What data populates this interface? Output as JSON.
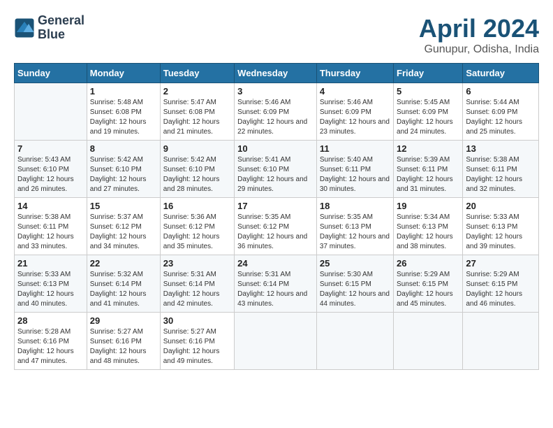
{
  "logo": {
    "line1": "General",
    "line2": "Blue"
  },
  "title": "April 2024",
  "subtitle": "Gunupur, Odisha, India",
  "weekdays": [
    "Sunday",
    "Monday",
    "Tuesday",
    "Wednesday",
    "Thursday",
    "Friday",
    "Saturday"
  ],
  "weeks": [
    [
      {
        "day": "",
        "sunrise": "",
        "sunset": "",
        "daylight": ""
      },
      {
        "day": "1",
        "sunrise": "Sunrise: 5:48 AM",
        "sunset": "Sunset: 6:08 PM",
        "daylight": "Daylight: 12 hours and 19 minutes."
      },
      {
        "day": "2",
        "sunrise": "Sunrise: 5:47 AM",
        "sunset": "Sunset: 6:08 PM",
        "daylight": "Daylight: 12 hours and 21 minutes."
      },
      {
        "day": "3",
        "sunrise": "Sunrise: 5:46 AM",
        "sunset": "Sunset: 6:09 PM",
        "daylight": "Daylight: 12 hours and 22 minutes."
      },
      {
        "day": "4",
        "sunrise": "Sunrise: 5:46 AM",
        "sunset": "Sunset: 6:09 PM",
        "daylight": "Daylight: 12 hours and 23 minutes."
      },
      {
        "day": "5",
        "sunrise": "Sunrise: 5:45 AM",
        "sunset": "Sunset: 6:09 PM",
        "daylight": "Daylight: 12 hours and 24 minutes."
      },
      {
        "day": "6",
        "sunrise": "Sunrise: 5:44 AM",
        "sunset": "Sunset: 6:09 PM",
        "daylight": "Daylight: 12 hours and 25 minutes."
      }
    ],
    [
      {
        "day": "7",
        "sunrise": "Sunrise: 5:43 AM",
        "sunset": "Sunset: 6:10 PM",
        "daylight": "Daylight: 12 hours and 26 minutes."
      },
      {
        "day": "8",
        "sunrise": "Sunrise: 5:42 AM",
        "sunset": "Sunset: 6:10 PM",
        "daylight": "Daylight: 12 hours and 27 minutes."
      },
      {
        "day": "9",
        "sunrise": "Sunrise: 5:42 AM",
        "sunset": "Sunset: 6:10 PM",
        "daylight": "Daylight: 12 hours and 28 minutes."
      },
      {
        "day": "10",
        "sunrise": "Sunrise: 5:41 AM",
        "sunset": "Sunset: 6:10 PM",
        "daylight": "Daylight: 12 hours and 29 minutes."
      },
      {
        "day": "11",
        "sunrise": "Sunrise: 5:40 AM",
        "sunset": "Sunset: 6:11 PM",
        "daylight": "Daylight: 12 hours and 30 minutes."
      },
      {
        "day": "12",
        "sunrise": "Sunrise: 5:39 AM",
        "sunset": "Sunset: 6:11 PM",
        "daylight": "Daylight: 12 hours and 31 minutes."
      },
      {
        "day": "13",
        "sunrise": "Sunrise: 5:38 AM",
        "sunset": "Sunset: 6:11 PM",
        "daylight": "Daylight: 12 hours and 32 minutes."
      }
    ],
    [
      {
        "day": "14",
        "sunrise": "Sunrise: 5:38 AM",
        "sunset": "Sunset: 6:11 PM",
        "daylight": "Daylight: 12 hours and 33 minutes."
      },
      {
        "day": "15",
        "sunrise": "Sunrise: 5:37 AM",
        "sunset": "Sunset: 6:12 PM",
        "daylight": "Daylight: 12 hours and 34 minutes."
      },
      {
        "day": "16",
        "sunrise": "Sunrise: 5:36 AM",
        "sunset": "Sunset: 6:12 PM",
        "daylight": "Daylight: 12 hours and 35 minutes."
      },
      {
        "day": "17",
        "sunrise": "Sunrise: 5:35 AM",
        "sunset": "Sunset: 6:12 PM",
        "daylight": "Daylight: 12 hours and 36 minutes."
      },
      {
        "day": "18",
        "sunrise": "Sunrise: 5:35 AM",
        "sunset": "Sunset: 6:13 PM",
        "daylight": "Daylight: 12 hours and 37 minutes."
      },
      {
        "day": "19",
        "sunrise": "Sunrise: 5:34 AM",
        "sunset": "Sunset: 6:13 PM",
        "daylight": "Daylight: 12 hours and 38 minutes."
      },
      {
        "day": "20",
        "sunrise": "Sunrise: 5:33 AM",
        "sunset": "Sunset: 6:13 PM",
        "daylight": "Daylight: 12 hours and 39 minutes."
      }
    ],
    [
      {
        "day": "21",
        "sunrise": "Sunrise: 5:33 AM",
        "sunset": "Sunset: 6:13 PM",
        "daylight": "Daylight: 12 hours and 40 minutes."
      },
      {
        "day": "22",
        "sunrise": "Sunrise: 5:32 AM",
        "sunset": "Sunset: 6:14 PM",
        "daylight": "Daylight: 12 hours and 41 minutes."
      },
      {
        "day": "23",
        "sunrise": "Sunrise: 5:31 AM",
        "sunset": "Sunset: 6:14 PM",
        "daylight": "Daylight: 12 hours and 42 minutes."
      },
      {
        "day": "24",
        "sunrise": "Sunrise: 5:31 AM",
        "sunset": "Sunset: 6:14 PM",
        "daylight": "Daylight: 12 hours and 43 minutes."
      },
      {
        "day": "25",
        "sunrise": "Sunrise: 5:30 AM",
        "sunset": "Sunset: 6:15 PM",
        "daylight": "Daylight: 12 hours and 44 minutes."
      },
      {
        "day": "26",
        "sunrise": "Sunrise: 5:29 AM",
        "sunset": "Sunset: 6:15 PM",
        "daylight": "Daylight: 12 hours and 45 minutes."
      },
      {
        "day": "27",
        "sunrise": "Sunrise: 5:29 AM",
        "sunset": "Sunset: 6:15 PM",
        "daylight": "Daylight: 12 hours and 46 minutes."
      }
    ],
    [
      {
        "day": "28",
        "sunrise": "Sunrise: 5:28 AM",
        "sunset": "Sunset: 6:16 PM",
        "daylight": "Daylight: 12 hours and 47 minutes."
      },
      {
        "day": "29",
        "sunrise": "Sunrise: 5:27 AM",
        "sunset": "Sunset: 6:16 PM",
        "daylight": "Daylight: 12 hours and 48 minutes."
      },
      {
        "day": "30",
        "sunrise": "Sunrise: 5:27 AM",
        "sunset": "Sunset: 6:16 PM",
        "daylight": "Daylight: 12 hours and 49 minutes."
      },
      {
        "day": "",
        "sunrise": "",
        "sunset": "",
        "daylight": ""
      },
      {
        "day": "",
        "sunrise": "",
        "sunset": "",
        "daylight": ""
      },
      {
        "day": "",
        "sunrise": "",
        "sunset": "",
        "daylight": ""
      },
      {
        "day": "",
        "sunrise": "",
        "sunset": "",
        "daylight": ""
      }
    ]
  ]
}
